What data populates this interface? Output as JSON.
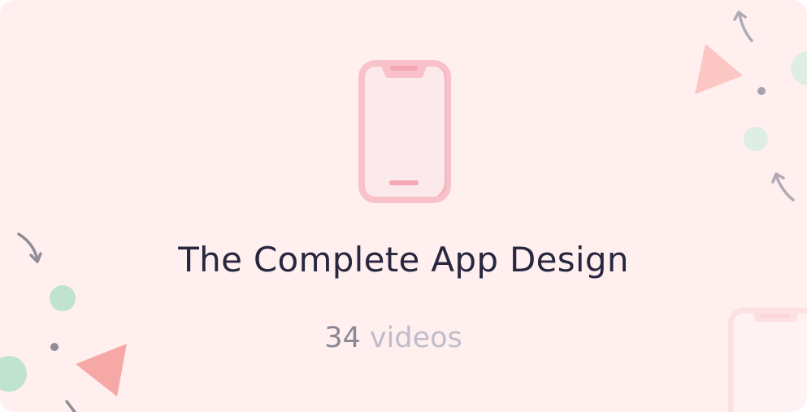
{
  "course_card": {
    "title": "The Complete App Design",
    "video_count": "34",
    "video_unit": "videos",
    "icon": "smartphone-icon",
    "colors": {
      "background": "#fff0ef",
      "title": "#28273f",
      "count": "#8a8796",
      "unit": "#c1bccb",
      "phone_outline": "#f9c1c9",
      "phone_accent": "#f4a7b4",
      "triangle": "#f6a8a6",
      "circle": "#bfe3cf",
      "arrow": "#8f8d97"
    }
  }
}
